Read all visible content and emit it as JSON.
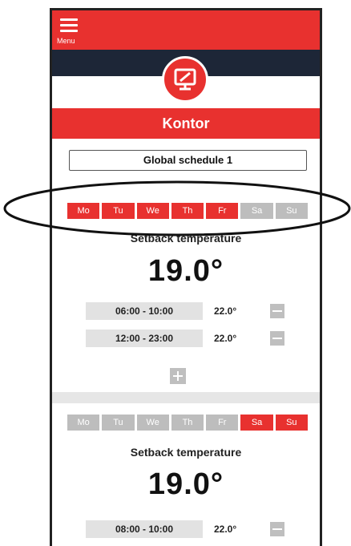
{
  "menu": {
    "label": "Menu"
  },
  "title": "Kontor",
  "schedule": {
    "name": "Global schedule 1"
  },
  "days": [
    "Mo",
    "Tu",
    "We",
    "Th",
    "Fr",
    "Sa",
    "Su"
  ],
  "blocks": [
    {
      "active_days": [
        "Mo",
        "Tu",
        "We",
        "Th",
        "Fr"
      ],
      "setback_label": "Setback temperature",
      "setback_temp": "19.0°",
      "rows": [
        {
          "time": "06:00 - 10:00",
          "temp": "22.0°"
        },
        {
          "time": "12:00 - 23:00",
          "temp": "22.0°"
        }
      ]
    },
    {
      "active_days": [
        "Sa",
        "Su"
      ],
      "setback_label": "Setback temperature",
      "setback_temp": "19.0°",
      "rows": [
        {
          "time": "08:00 - 10:00",
          "temp": "22.0°"
        }
      ]
    }
  ],
  "colors": {
    "accent": "#e8312f",
    "navy": "#1d2637",
    "inactive_day": "#bdbdbd"
  }
}
